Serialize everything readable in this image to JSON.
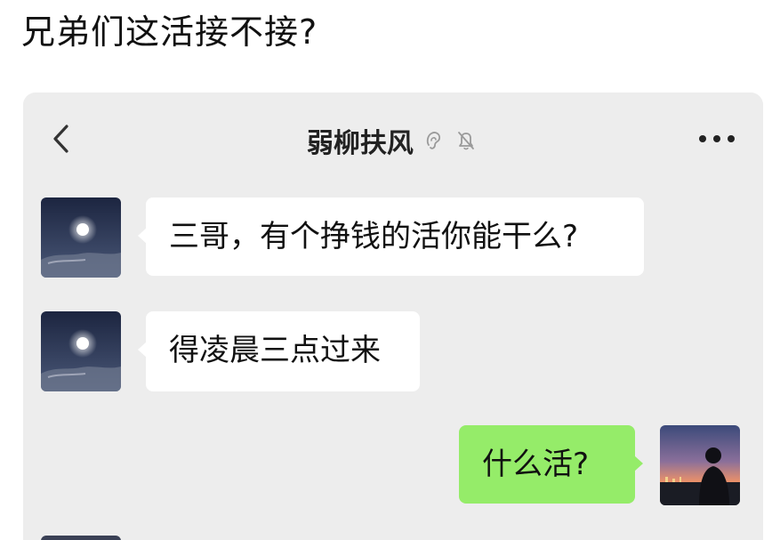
{
  "post": {
    "title": "兄弟们这活接不接?"
  },
  "chat": {
    "header": {
      "contact_name": "弱柳扶风",
      "icons": [
        "back-chevron-icon",
        "ear-icon",
        "mute-bell-icon",
        "more-dots-icon"
      ]
    },
    "messages": [
      {
        "side": "incoming",
        "avatar": "moon-night-sky-avatar",
        "text": "三哥，有个挣钱的活你能干么?"
      },
      {
        "side": "incoming",
        "avatar": "moon-night-sky-avatar",
        "text": "得凌晨三点过来"
      },
      {
        "side": "outgoing",
        "avatar": "silhouette-sunset-avatar",
        "text": "什么活?"
      }
    ]
  },
  "colors": {
    "chat_background": "#ededed",
    "incoming_bubble": "#ffffff",
    "outgoing_bubble": "#95ec69",
    "text": "#111111"
  }
}
